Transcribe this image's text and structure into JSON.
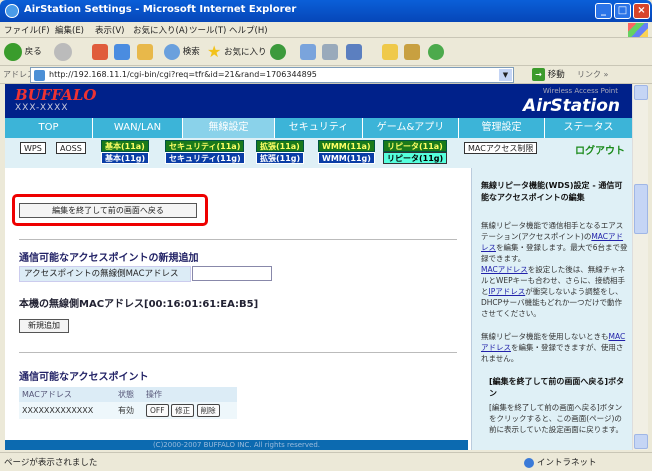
{
  "window": {
    "title": "AirStation Settings - Microsoft Internet Explorer"
  },
  "menu": [
    "ファイル(F)",
    "編集(E)",
    "表示(V)",
    "お気に入り(A)",
    "ツール(T)",
    "ヘルプ(H)"
  ],
  "toolbar": {
    "back": "戻る",
    "search": "検索",
    "favorites": "お気に入り"
  },
  "address": {
    "label": "アドレス(D)",
    "url": "http://192.168.11.1/cgi-bin/cgi?req=tfr&id=21&rand=1706344895",
    "go": "移動",
    "links": "リンク"
  },
  "header": {
    "brand": "BUFFALO",
    "model": "XXX-XXXX",
    "tag": "Wireless Access Point",
    "product": "AirStation"
  },
  "main_tabs": [
    "TOP",
    "WAN/LAN",
    "無線設定",
    "セキュリティ",
    "ゲーム&アプリ",
    "管理設定",
    "ステータス"
  ],
  "sub_tabs": {
    "wps": "WPS",
    "aoss": "AOSS",
    "basic_a": "基本(11a)",
    "basic_g": "基本(11g)",
    "sec_a": "セキュリティ(11a)",
    "sec_g": "セキュリティ(11g)",
    "ext_a": "拡張(11a)",
    "ext_g": "拡張(11g)",
    "wmm_a": "WMM(11a)",
    "wmm_g": "WMM(11g)",
    "rep_a": "リピータ(11a)",
    "rep_g": "リピータ(11g)",
    "mac": "MACアクセス制限",
    "logout": "ログアウト"
  },
  "content": {
    "edit_button": "編集を終了して前の画面へ戻る",
    "new_ap_title": "通信可能なアクセスポイントの新規追加",
    "mac_field_label": "アクセスポイントの無線側MACアドレス",
    "mac_field_value": "",
    "self_mac": "本機の無線側MACアドレス[00:16:01:61:EA:B5]",
    "add_button": "新規追加",
    "ap_list_title": "通信可能なアクセスポイント",
    "table_headers": [
      "MACアドレス",
      "状態",
      "操作"
    ],
    "table_rows": [
      {
        "mac": "XXXXXXXXXXXXX",
        "status": "有効",
        "btn_off": "OFF",
        "btn_edit": "修正",
        "btn_delete": "削除"
      }
    ],
    "footer": "(C)2000-2007 BUFFALO INC. All rights reserved."
  },
  "help": {
    "title": "無線リピータ機能(WDS)設定 - 通信可能なアクセスポイントの編集",
    "para1_a": "無線リピータ機能で通信相手となるエアステーション(アクセスポイント)の",
    "para1_link": "MACアドレス",
    "para1_b": "を編集・登録します。最大で6台まで登録できます。",
    "para2_link1": "MACアドレス",
    "para2_a": "を設定した後は、無線チャネルとWEPキーも合わせ、さらに、接続相手と",
    "para2_link2": "IPアドレス",
    "para2_b": "が衝突しないよう調整をし、DHCPサーバ機能もどれか一つだけで動作させてください。",
    "para3_a": "無線リピータ機能を使用しないときも",
    "para3_link": "MACアドレス",
    "para3_b": "を編集・登録できますが、使用されません。",
    "sub_title": "[編集を終了して前の画面へ戻る]ボタン",
    "sub_para": "[編集を終了して前の画面へ戻る]ボタンをクリックすると、この画面(ページ)の前に表示していた設定画面に戻ります。"
  },
  "status": {
    "left": "ページが表示されました",
    "zone": "イントラネット"
  }
}
